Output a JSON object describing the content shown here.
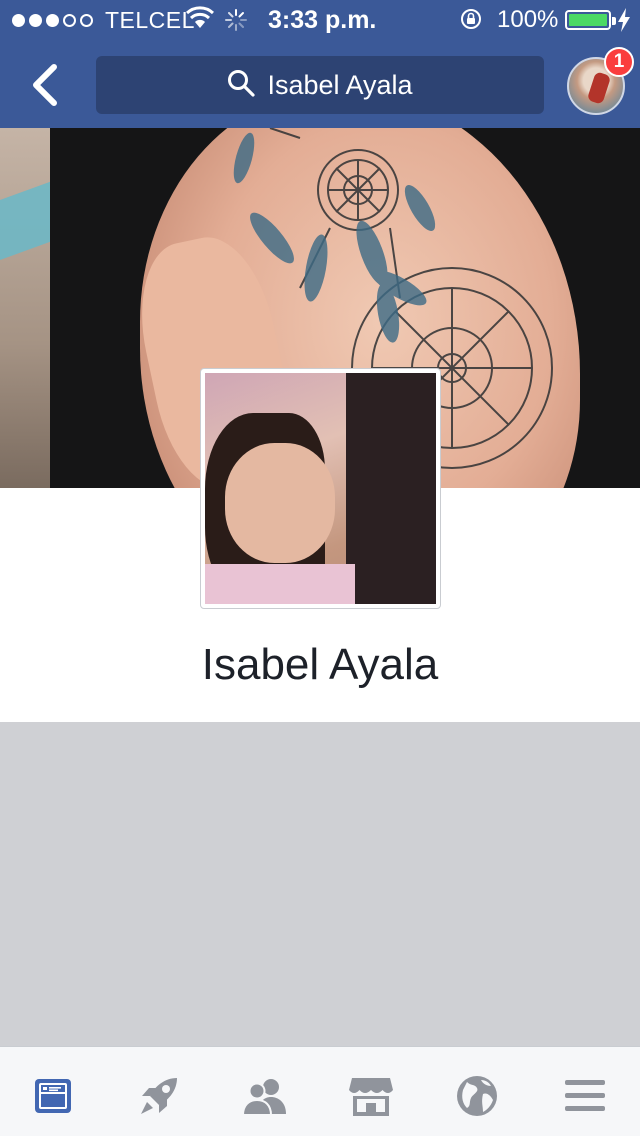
{
  "status_bar": {
    "signal_dots_filled": 3,
    "signal_dots_total": 5,
    "carrier": "TELCEL",
    "time": "3:33 p.m.",
    "battery_percent": "100%",
    "battery_level": 1.0,
    "icons": [
      "wifi-icon",
      "activity-spinner-icon",
      "rotation-lock-icon",
      "charging-bolt-icon"
    ]
  },
  "nav": {
    "back_icon": "chevron-left-icon",
    "search_icon": "search-icon",
    "search_query": "Isabel Ayala",
    "notification_count": "1"
  },
  "profile": {
    "name": "Isabel Ayala"
  },
  "tabbar": {
    "items": [
      {
        "icon": "news-feed-icon",
        "active": true
      },
      {
        "icon": "rocket-icon",
        "active": false
      },
      {
        "icon": "friends-icon",
        "active": false
      },
      {
        "icon": "marketplace-icon",
        "active": false
      },
      {
        "icon": "globe-icon",
        "active": false
      },
      {
        "icon": "menu-icon",
        "active": false
      }
    ]
  },
  "colors": {
    "brand": "#3b5998",
    "search_bg": "#2d4373",
    "active_tab": "#4267b2",
    "inactive_tab": "#90949c",
    "badge": "#fa3e3e",
    "battery": "#4cd964"
  }
}
